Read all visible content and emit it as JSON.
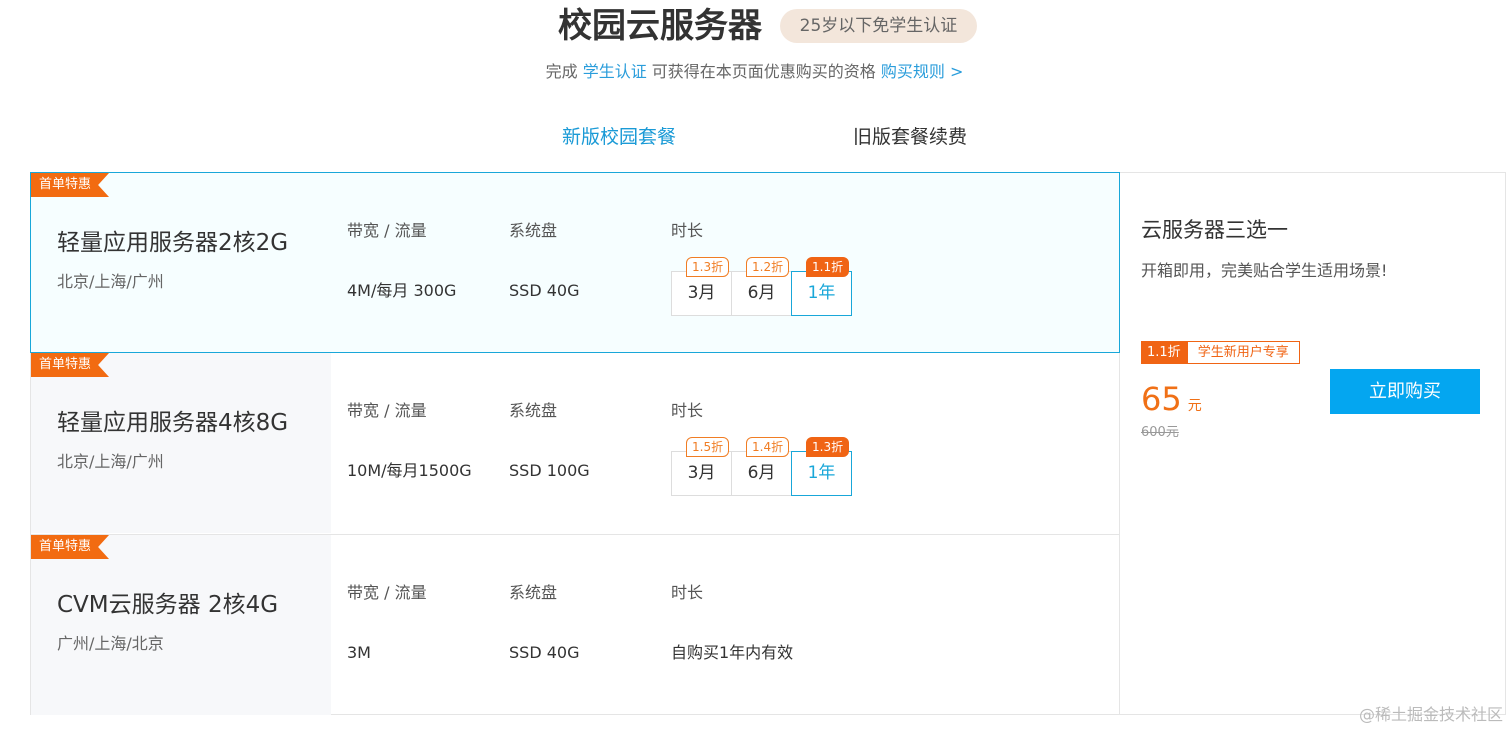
{
  "header": {
    "title": "校园云服务器",
    "age_badge": "25岁以下免学生认证",
    "subtitle_prefix": "完成 ",
    "subtitle_link": "学生认证",
    "subtitle_middle": " 可获得在本页面优惠购买的资格 ",
    "rules_link": "购买规则 >"
  },
  "tabs": [
    {
      "label": "新版校园套餐",
      "active": true
    },
    {
      "label": "旧版套餐续费",
      "active": false
    }
  ],
  "column_labels": {
    "bandwidth": "带宽 / 流量",
    "disk": "系统盘",
    "duration": "时长"
  },
  "plans": [
    {
      "tag": "首单特惠",
      "name": "轻量应用服务器2核2G",
      "region": "北京/上海/广州",
      "bandwidth": "4M/每月 300G",
      "disk": "SSD 40G",
      "durations": [
        {
          "label": "3月",
          "discount": "1.3折",
          "selected": false
        },
        {
          "label": "6月",
          "discount": "1.2折",
          "selected": false
        },
        {
          "label": "1年",
          "discount": "1.1折",
          "selected": true
        }
      ]
    },
    {
      "tag": "首单特惠",
      "name": "轻量应用服务器4核8G",
      "region": "北京/上海/广州",
      "bandwidth": "10M/每月1500G",
      "disk": "SSD 100G",
      "durations": [
        {
          "label": "3月",
          "discount": "1.5折",
          "selected": false
        },
        {
          "label": "6月",
          "discount": "1.4折",
          "selected": false
        },
        {
          "label": "1年",
          "discount": "1.3折",
          "selected": true
        }
      ]
    },
    {
      "tag": "首单特惠",
      "name": "CVM云服务器 2核4G",
      "region": "广州/上海/北京",
      "bandwidth": "3M",
      "disk": "SSD 40G",
      "duration_text": "自购买1年内有效"
    }
  ],
  "side_panel": {
    "title": "云服务器三选一",
    "desc": "开箱即用，完美贴合学生适用场景!",
    "discount": "1.1折",
    "new_user": "学生新用户专享",
    "price": "65",
    "price_unit": "元",
    "original_price": "600元",
    "buy_label": "立即购买"
  },
  "watermark": "@稀土掘金技术社区",
  "colors": {
    "accent_blue": "#19a7d9",
    "buy_button": "#04a6f0",
    "orange": "#f06414"
  }
}
